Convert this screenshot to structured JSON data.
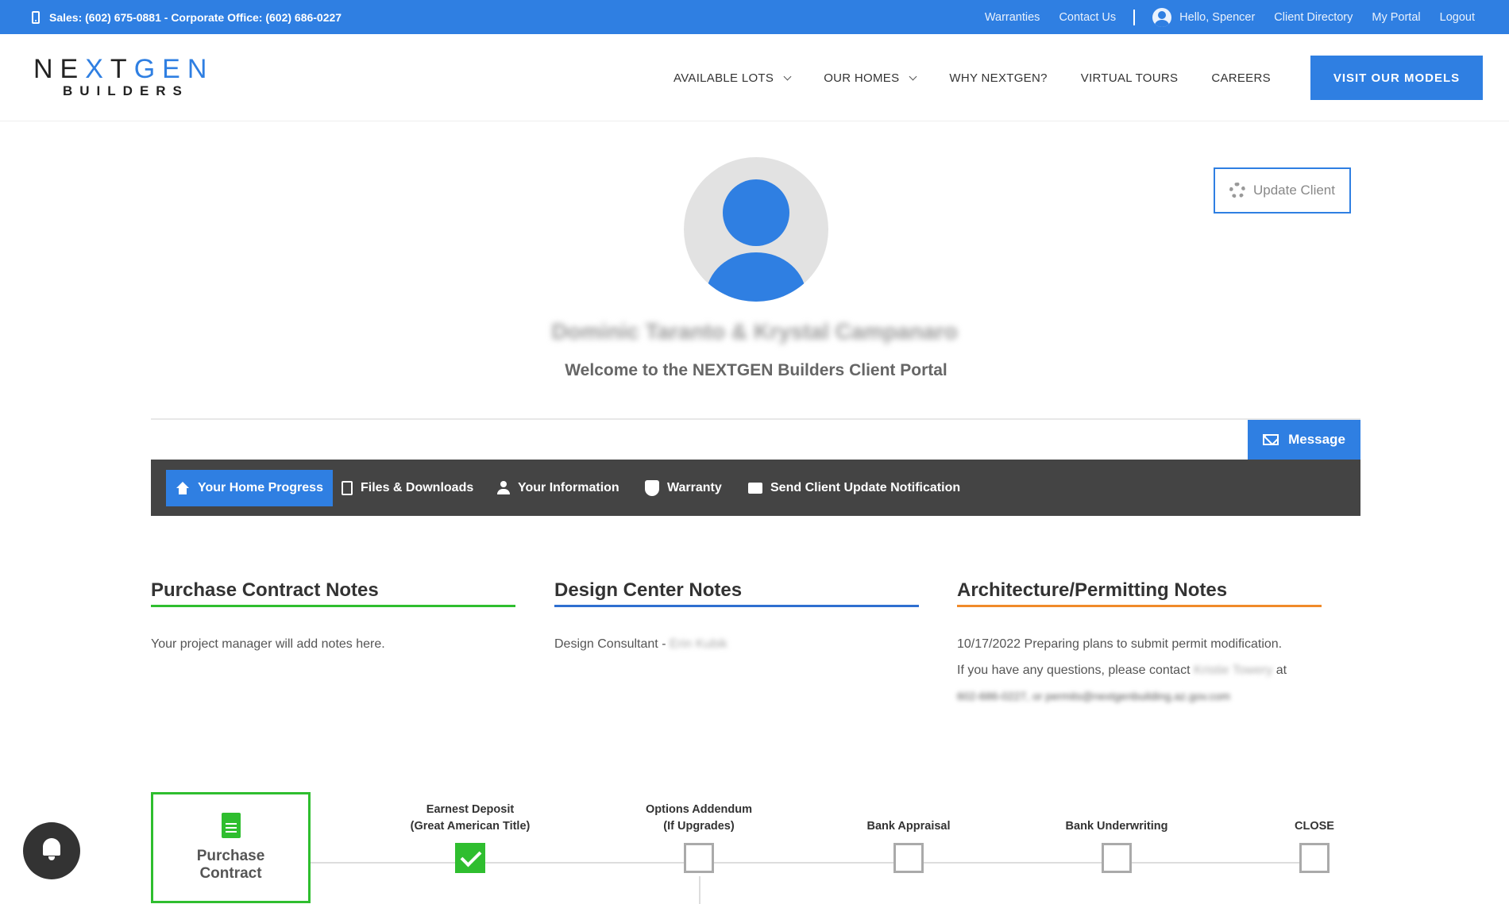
{
  "topbar": {
    "phone_text": "Sales: (602) 675-0881 - Corporate Office: (602) 686-0227",
    "links": {
      "warranties": "Warranties",
      "contact_us": "Contact Us",
      "greeting": "Hello, Spencer",
      "client_directory": "Client Directory",
      "my_portal": "My Portal",
      "logout": "Logout"
    }
  },
  "logo": {
    "part1": "NE",
    "part2": "X",
    "part3": "T",
    "part4": "GEN",
    "sub": "BUILDERS"
  },
  "nav": {
    "available_lots": "AVAILABLE LOTS",
    "our_homes": "OUR HOMES",
    "why": "WHY NEXTGEN?",
    "virtual_tours": "VIRTUAL TOURS",
    "careers": "CAREERS",
    "visit_btn": "VISIT OUR MODELS"
  },
  "profile": {
    "name": "Dominic Taranto & Krystal Campanaro",
    "welcome": "Welcome to the NEXTGEN Builders Client Portal",
    "update_btn": "Update Client",
    "message_btn": "Message"
  },
  "tabs": {
    "home_progress": "Your Home Progress",
    "files": "Files & Downloads",
    "info": "Your Information",
    "warranty": "Warranty",
    "send_update": "Send Client Update Notification"
  },
  "notes": {
    "purchase": {
      "title": "Purchase Contract Notes",
      "text": "Your project manager will add notes here.",
      "color": "#2fbe2f"
    },
    "design": {
      "title": "Design Center Notes",
      "text_prefix": "Design Consultant - ",
      "text_blurred": "Erin Kubik",
      "color": "#2f6fd0"
    },
    "arch": {
      "title": "Architecture/Permitting Notes",
      "line1": "10/17/2022 Preparing plans to submit permit modification.",
      "line2_prefix": "If you have any questions, please contact ",
      "line2_blurred": "Kristie Towery",
      "line2_suffix": " at",
      "line3_blurred": "602-686-0227, or permits@nextgenbuilding.az.gov.com",
      "color": "#f08a2a"
    }
  },
  "progress": {
    "first": "Purchase Contract",
    "stages": [
      {
        "line1": "Earnest Deposit",
        "line2": "(Great American Title)",
        "done": true
      },
      {
        "line1": "Options Addendum",
        "line2": "(If Upgrades)",
        "done": false
      },
      {
        "line1": "",
        "line2": "Bank Appraisal",
        "done": false
      },
      {
        "line1": "",
        "line2": "Bank Underwriting",
        "done": false
      },
      {
        "line1": "",
        "line2": "CLOSE",
        "done": false
      }
    ]
  },
  "icons": {
    "phone": "phone-icon",
    "user": "user-icon",
    "gear": "gear-icon",
    "envelope": "envelope-icon",
    "home": "home-icon",
    "file": "file-icon",
    "person": "person-icon",
    "shield": "shield-icon",
    "mail": "mail-icon",
    "document": "document-icon",
    "bell": "bell-icon",
    "check": "check-icon"
  }
}
